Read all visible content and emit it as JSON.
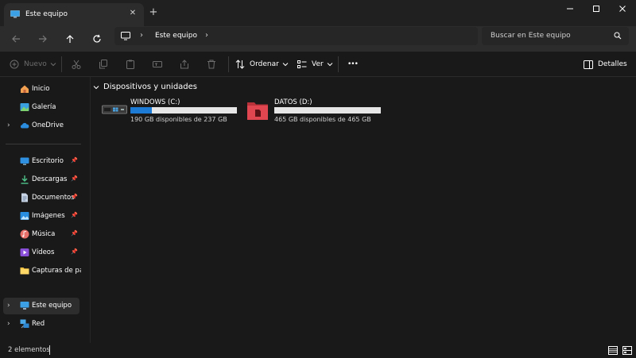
{
  "window": {
    "tab_title": "Este equipo",
    "tab_close_glyph": "✕",
    "new_tab_glyph": "+"
  },
  "address_bar": {
    "crumbs": [
      "Este equipo"
    ],
    "search_placeholder": "Buscar en Este equipo"
  },
  "toolbar": {
    "new_label": "Nuevo",
    "sort_label": "Ordenar",
    "view_label": "Ver",
    "more_glyph": "•••",
    "details_label": "Detalles"
  },
  "sidebar": {
    "top_items": [
      {
        "label": "Inicio",
        "icon": "home-icon"
      },
      {
        "label": "Galería",
        "icon": "gallery-icon"
      },
      {
        "label": "OneDrive",
        "icon": "cloud-icon"
      }
    ],
    "quick_access": [
      {
        "label": "Escritorio",
        "icon": "desktop-icon"
      },
      {
        "label": "Descargas",
        "icon": "download-icon"
      },
      {
        "label": "Documentos",
        "icon": "documents-icon"
      },
      {
        "label": "Imágenes",
        "icon": "pictures-icon"
      },
      {
        "label": "Música",
        "icon": "music-icon"
      },
      {
        "label": "Vídeos",
        "icon": "videos-icon"
      },
      {
        "label": "Capturas de pantalla",
        "icon": "folder-icon"
      }
    ],
    "bottom_items": [
      {
        "label": "Este equipo",
        "icon": "computer-icon"
      },
      {
        "label": "Red",
        "icon": "network-icon"
      }
    ]
  },
  "main": {
    "section_title": "Dispositivos y unidades",
    "drives": [
      {
        "name": "WINDOWS (C:)",
        "free_text": "190 GB disponibles de 237 GB",
        "used_fraction": 0.2
      },
      {
        "name": "DATOS (D:)",
        "free_text": "465 GB disponibles de 465 GB",
        "used_fraction": 0.0
      }
    ]
  },
  "status_bar": {
    "item_count": "2 elementos"
  },
  "colors": {
    "accent": "#1d7bd6",
    "background": "#191919",
    "chrome": "#2c2c2c"
  }
}
